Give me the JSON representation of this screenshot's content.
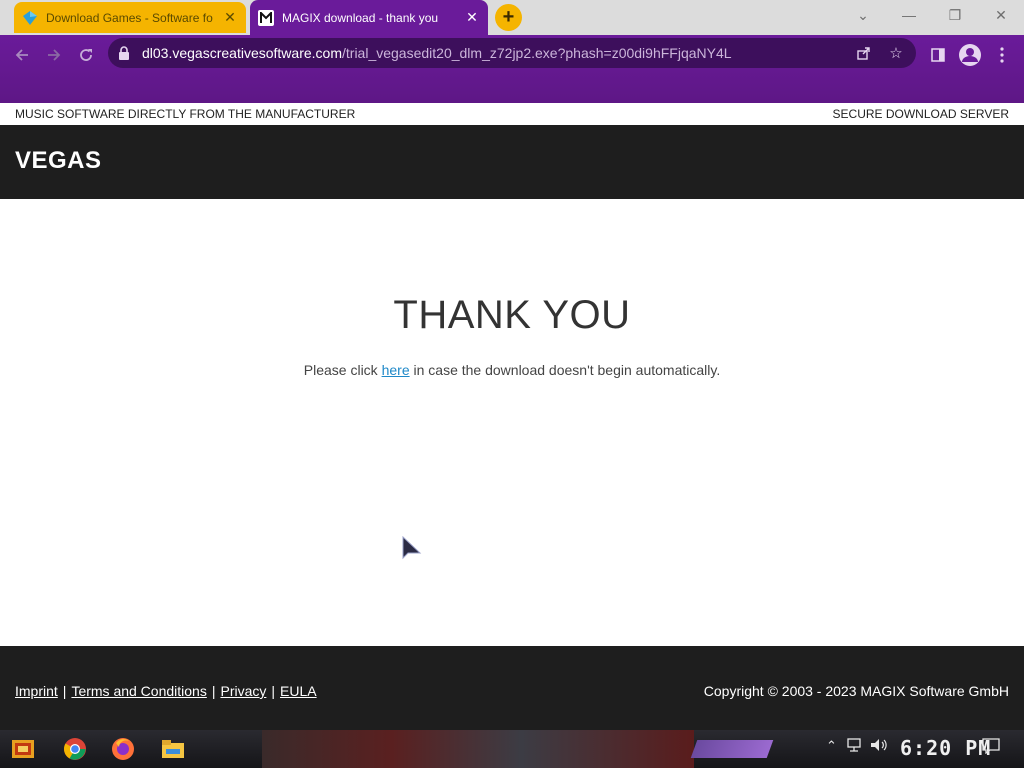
{
  "browser": {
    "tabs": [
      {
        "title": "Download Games - Software fo",
        "favicon": "gem-icon",
        "active": false,
        "color": "#f5b400"
      },
      {
        "title": "MAGIX download - thank you",
        "favicon": "magix-m-icon",
        "active": true,
        "color": "#6a1b9a"
      }
    ],
    "new_tab_label": "+",
    "address": {
      "host": "dl03.vegascreativesoftware.com",
      "path": "/trial_vegasedit20_dlm_z72jp2.exe?phash=z00di9hFFjqaNY4L"
    },
    "accent": "#6a1b9a"
  },
  "page": {
    "top_left": "MUSIC SOFTWARE DIRECTLY FROM THE MANUFACTURER",
    "top_right": "SECURE DOWNLOAD SERVER",
    "logo": "VEGAS",
    "heading": "THANK YOU",
    "message_before": "Please click ",
    "message_link": "here",
    "message_after": " in case the download doesn't begin automatically.",
    "link_color": "#1e88c8"
  },
  "footer": {
    "links": [
      "Imprint",
      "Terms and Conditions",
      "Privacy",
      "EULA"
    ],
    "separator": "|",
    "copyright": "Copyright © 2003 - 2023 MAGIX Software GmbH"
  },
  "taskbar": {
    "apps": [
      "start-icon",
      "chrome-icon",
      "firefox-icon",
      "file-explorer-icon"
    ],
    "clock": "6:20 PM"
  }
}
